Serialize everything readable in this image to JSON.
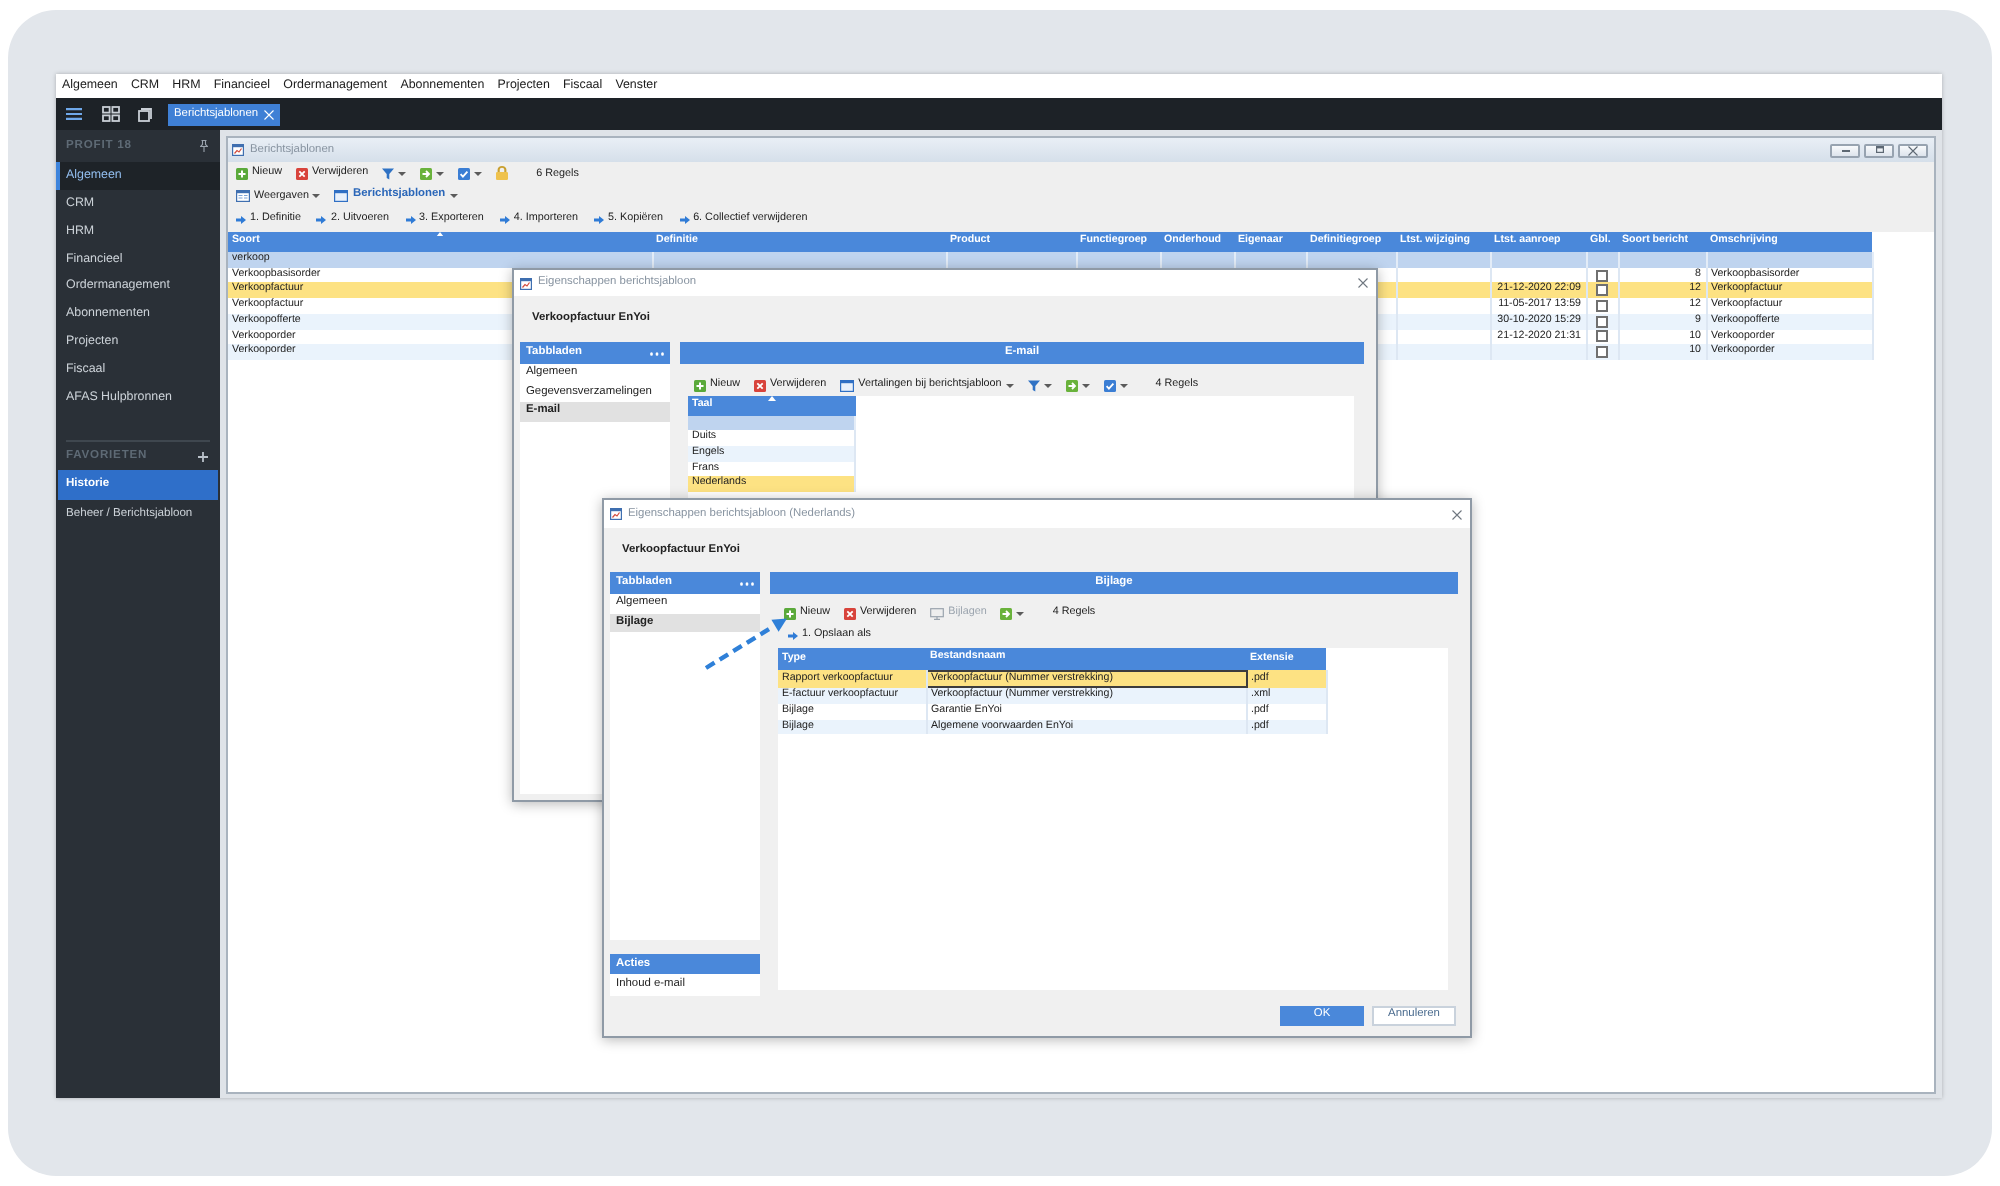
{
  "menu_bar": [
    "Algemeen",
    "CRM",
    "HRM",
    "Financieel",
    "Ordermanagement",
    "Abonnementen",
    "Projecten",
    "Fiscaal",
    "Venster"
  ],
  "top_bar": {
    "tabs": [
      {
        "label": "Berichtsjablonen",
        "selected": true
      }
    ]
  },
  "sidebar": {
    "title": "PROFIT 18",
    "items": [
      {
        "label": "Algemeen",
        "selected": true
      },
      {
        "label": "CRM",
        "selected": false
      },
      {
        "label": "HRM",
        "selected": false
      },
      {
        "label": "Financieel",
        "selected": false
      },
      {
        "label": "Ordermanagement",
        "selected": false
      },
      {
        "label": "Abonnementen",
        "selected": false
      },
      {
        "label": "Projecten",
        "selected": false
      },
      {
        "label": "Fiscaal",
        "selected": false
      },
      {
        "label": "AFAS Hulpbronnen",
        "selected": false
      }
    ],
    "favorites_title": "FAVORIETEN",
    "favorites": [
      {
        "label": "Historie",
        "selected": true
      },
      {
        "label": "Beheer / Berichtsjabloon",
        "selected": false
      }
    ]
  },
  "main_window": {
    "title": "Berichtsjablonen",
    "toolbar_rows": [
      [
        {
          "kind": "add",
          "label": "Nieuw",
          "dropdown": false
        },
        {
          "kind": "delete",
          "label": "Verwijderen",
          "dropdown": false
        },
        {
          "kind": "filter",
          "dropdown": true
        },
        {
          "kind": "move",
          "dropdown": true
        },
        {
          "kind": "check",
          "dropdown": true
        },
        {
          "kind": "lock",
          "dropdown": false
        },
        {
          "kind": "count",
          "label": "6 Regels"
        }
      ],
      [
        {
          "kind": "views",
          "label": "Weergaven",
          "dropdown": true
        },
        {
          "kind": "current_view",
          "label": "Berichtsjablonen",
          "dropdown": true
        }
      ]
    ],
    "actions": [
      "1. Definitie",
      "2. Uitvoeren",
      "3. Exporteren",
      "4. Importeren",
      "5. Kopiëren",
      "6. Collectief verwijderen"
    ],
    "table": {
      "filter_row": true,
      "columns": [
        {
          "label": "Soort",
          "sorted": true,
          "filter": "verkoop"
        },
        {
          "label": "Definitie",
          "sorted": false
        },
        {
          "label": "Product",
          "sorted": false
        },
        {
          "label": "Functiegroep",
          "sorted": false
        },
        {
          "label": "Onderhoud",
          "sorted": false
        },
        {
          "label": "Eigenaar",
          "sorted": false
        },
        {
          "label": "Definitiegroep",
          "sorted": false
        },
        {
          "label": "Ltst. wijziging",
          "sorted": false
        },
        {
          "label": "Ltst. aanroep",
          "sorted": false
        },
        {
          "label": "Gbl.",
          "sorted": false
        },
        {
          "label": "Soort bericht",
          "sorted": false
        },
        {
          "label": "Omschrijving",
          "sorted": false
        }
      ],
      "rows": [
        {
          "selected": false,
          "soort": "Verkoopbasisorder",
          "gbl": false,
          "soort_bericht": "8",
          "omschrijving": "Verkoopbasisorder"
        },
        {
          "selected": true,
          "soort": "Verkoopfactuur",
          "ltst_aanroep": "21-12-2020 22:09",
          "gbl": false,
          "soort_bericht": "12",
          "omschrijving": "Verkoopfactuur"
        },
        {
          "selected": false,
          "soort": "Verkoopfactuur",
          "ltst_aanroep": "11-05-2017 13:59",
          "gbl": false,
          "soort_bericht": "12",
          "omschrijving": "Verkoopfactuur"
        },
        {
          "selected": false,
          "soort": "Verkoopofferte",
          "ltst_aanroep": "30-10-2020 15:29",
          "gbl": false,
          "soort_bericht": "9",
          "omschrijving": "Verkoopofferte"
        },
        {
          "selected": false,
          "soort": "Verkooporder",
          "ltst_aanroep": "21-12-2020 21:31",
          "gbl": false,
          "soort_bericht": "10",
          "omschrijving": "Verkooporder"
        },
        {
          "selected": false,
          "soort": "Verkooporder",
          "gbl": false,
          "soort_bericht": "10",
          "omschrijving": "Verkooporder"
        }
      ]
    }
  },
  "dialogs": [
    {
      "title": "Eigenschappen berichtsjabloon",
      "heading": "Verkoopfactuur EnYoi",
      "tabs_title": "Tabbladen",
      "tabs": [
        {
          "label": "Algemeen",
          "selected": false
        },
        {
          "label": "Gegevensverzamelingen",
          "selected": false
        },
        {
          "label": "E-mail",
          "selected": true
        }
      ],
      "panel_title": "E-mail",
      "toolbar": [
        {
          "kind": "add",
          "label": "Nieuw",
          "dropdown": false
        },
        {
          "kind": "delete",
          "label": "Verwijderen",
          "dropdown": false
        },
        {
          "kind": "window",
          "label": "Vertalingen bij berichtsjabloon",
          "dropdown": true
        },
        {
          "kind": "filter",
          "dropdown": true
        },
        {
          "kind": "move",
          "dropdown": true
        },
        {
          "kind": "check",
          "dropdown": true
        },
        {
          "kind": "count",
          "label": "4 Regels"
        }
      ],
      "table": {
        "filter_row": true,
        "columns": [
          {
            "label": "Taal",
            "sorted": true
          }
        ],
        "rows": [
          {
            "selected": false,
            "cells": [
              "Duits"
            ]
          },
          {
            "selected": false,
            "cells": [
              "Engels"
            ]
          },
          {
            "selected": false,
            "cells": [
              "Frans"
            ]
          },
          {
            "selected": true,
            "cells": [
              "Nederlands"
            ]
          }
        ]
      }
    },
    {
      "title": "Eigenschappen berichtsjabloon (Nederlands)",
      "heading": "Verkoopfactuur EnYoi",
      "tabs_title": "Tabbladen",
      "tabs": [
        {
          "label": "Algemeen",
          "selected": false
        },
        {
          "label": "Bijlage",
          "selected": true
        }
      ],
      "actions_title": "Acties",
      "actions": [
        "Inhoud e-mail"
      ],
      "panel_title": "Bijlage",
      "toolbar": [
        {
          "kind": "add",
          "label": "Nieuw",
          "dropdown": false,
          "disabled": false
        },
        {
          "kind": "delete",
          "label": "Verwijderen",
          "dropdown": false,
          "disabled": false
        },
        {
          "kind": "attachments",
          "label": "Bijlagen",
          "dropdown": false,
          "disabled": true
        },
        {
          "kind": "move",
          "dropdown": true,
          "disabled": false
        },
        {
          "kind": "count",
          "label": "4 Regels",
          "disabled": false
        }
      ],
      "callout_arrow": true,
      "links": [
        "1. Opslaan als"
      ],
      "table": {
        "filter_row": false,
        "columns": [
          {
            "label": "Type",
            "sorted": false
          },
          {
            "label": "Bestandsnaam",
            "sorted": false
          },
          {
            "label": "Extensie",
            "sorted": false
          }
        ],
        "rows": [
          {
            "selected": true,
            "cells": [
              {
                "text": "Rapport verkoopfactuur",
                "focused": false
              },
              {
                "text": "Verkoopfactuur (Nummer verstrekking)",
                "focused": true
              },
              {
                "text": ".pdf",
                "focused": false
              }
            ]
          },
          {
            "selected": false,
            "cells": [
              {
                "text": "E-factuur verkoopfactuur",
                "focused": false
              },
              {
                "text": "Verkoopfactuur (Nummer verstrekking)",
                "focused": false
              },
              {
                "text": ".xml",
                "focused": false
              }
            ]
          },
          {
            "selected": false,
            "cells": [
              {
                "text": "Bijlage",
                "focused": false
              },
              {
                "text": "Garantie EnYoi",
                "focused": false
              },
              {
                "text": ".pdf",
                "focused": false
              }
            ]
          },
          {
            "selected": false,
            "cells": [
              {
                "text": "Bijlage",
                "focused": false
              },
              {
                "text": "Algemene voorwaarden EnYoi",
                "focused": false
              },
              {
                "text": ".pdf",
                "focused": false
              }
            ]
          }
        ]
      },
      "buttons": [
        {
          "label": "OK",
          "kind": "primary"
        },
        {
          "label": "Annuleren",
          "kind": "secondary"
        }
      ]
    }
  ]
}
